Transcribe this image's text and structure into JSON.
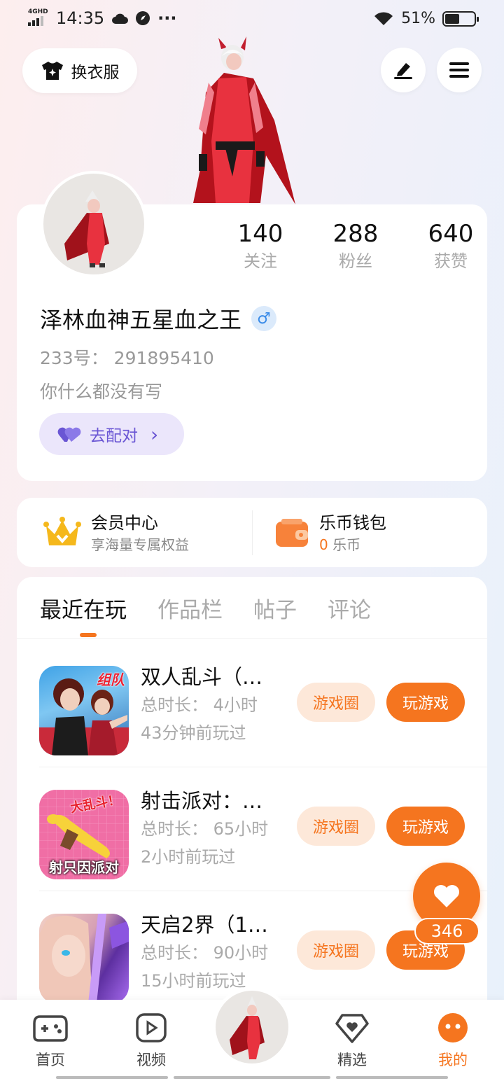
{
  "status_bar": {
    "network": "4GHD",
    "time": "14:35",
    "extra": "···",
    "battery_pct": "51%",
    "battery_level": 0.51
  },
  "header": {
    "outfit_label": "换衣服",
    "edit_icon": "pen-icon",
    "menu_icon": "hamburger-menu-icon"
  },
  "profile": {
    "stats": [
      {
        "value": "140",
        "label": "关注"
      },
      {
        "value": "288",
        "label": "粉丝"
      },
      {
        "value": "640",
        "label": "获赞"
      }
    ],
    "username": "泽林血神五星血之王",
    "gender_symbol": "♂",
    "uid": "233号： 291895410",
    "bio": "你什么都没有写",
    "match_label": "去配对",
    "match_chevron": "›"
  },
  "wallet": {
    "vip_title": "会员中心",
    "vip_sub": "享海量专属权益",
    "coin_title": "乐币钱包",
    "coin_amount": "0",
    "coin_unit": "乐币"
  },
  "tabs": [
    "最近在玩",
    "作品栏",
    "帖子",
    "评论"
  ],
  "games": [
    {
      "title": "双人乱斗（…",
      "duration": "总时长： 4小时",
      "last_played": "43分钟前玩过",
      "circle_label": "游戏圈",
      "play_label": "玩游戏",
      "icon_text": "组队"
    },
    {
      "title": "射击派对：…",
      "duration": "总时长： 65小时",
      "last_played": "2小时前玩过",
      "circle_label": "游戏圈",
      "play_label": "玩游戏",
      "icon_text_top": "大乱斗！",
      "icon_text_bottom": "射只因派对"
    },
    {
      "title": "天启2界（1…",
      "duration": "总时长： 90小时",
      "last_played": "15小时前玩过",
      "circle_label": "游戏圈",
      "play_label": "玩游戏"
    }
  ],
  "like": {
    "count": "346"
  },
  "bottom_nav": [
    {
      "label": "首页",
      "icon": "gamepad-icon"
    },
    {
      "label": "视频",
      "icon": "video-play-icon"
    },
    {
      "label": "",
      "icon": "center-avatar"
    },
    {
      "label": "精选",
      "icon": "heart-diamond-icon"
    },
    {
      "label": "我的",
      "icon": "my-face-icon"
    }
  ],
  "colors": {
    "accent": "#f5751f",
    "purple": "#6a56d4",
    "gold": "#f5b81c"
  }
}
